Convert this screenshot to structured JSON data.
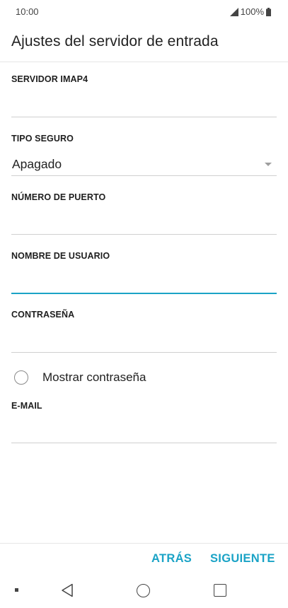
{
  "status_bar": {
    "time": "10:00",
    "battery": "100%",
    "icons": [
      "signal-icon",
      "battery-icon"
    ]
  },
  "header": {
    "title": "Ajustes del servidor de entrada"
  },
  "form": {
    "server": {
      "label": "SERVIDOR IMAP4",
      "value": "",
      "placeholder": ""
    },
    "security": {
      "label": "TIPO SEGURO",
      "value": "Apagado"
    },
    "port": {
      "label": "NÚMERO DE PUERTO",
      "value": "",
      "placeholder": ""
    },
    "username": {
      "label": "NOMBRE DE USUARIO",
      "value": "",
      "placeholder": ""
    },
    "password": {
      "label": "CONTRASEÑA",
      "value": "",
      "placeholder": ""
    },
    "show_password": {
      "label": "Mostrar contraseña",
      "checked": false
    },
    "email": {
      "label": "E-MAIL",
      "value": "",
      "placeholder": ""
    }
  },
  "actions": {
    "back_label": "ATRÁS",
    "next_label": "SIGUIENTE"
  },
  "theme": {
    "accent": "#1aa3c6"
  }
}
